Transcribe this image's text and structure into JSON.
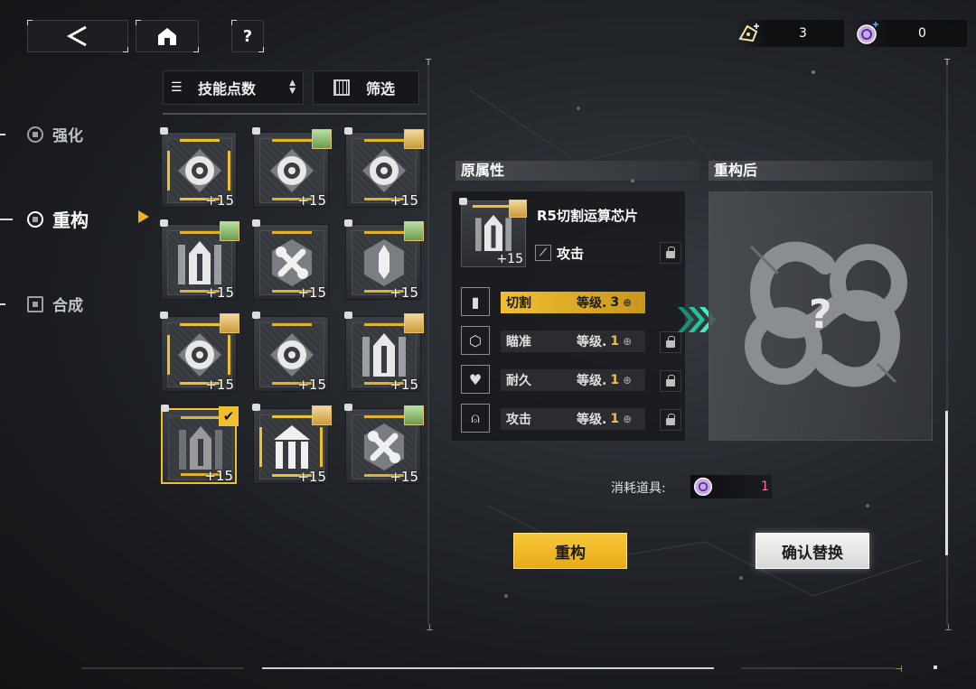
{
  "header": {
    "back_icon": "back-arrow-icon",
    "home_icon": "home-icon",
    "help_icon": "question-icon",
    "resources": [
      {
        "icon": "material-ticket-icon",
        "value": "3"
      },
      {
        "icon": "reconstruct-token-icon",
        "value": "0"
      }
    ]
  },
  "nav": {
    "items": [
      {
        "label": "强化",
        "active": false
      },
      {
        "label": "重构",
        "active": true
      },
      {
        "label": "合成",
        "active": false
      }
    ]
  },
  "toolbar": {
    "sort_label": "技能点数",
    "filter_label": "筛选"
  },
  "inventory": {
    "cards": [
      {
        "icon": "target",
        "level": "+15",
        "avatar": false,
        "gold": true,
        "selected": false
      },
      {
        "icon": "target",
        "level": "+15",
        "avatar": true,
        "gold": false,
        "selected": false
      },
      {
        "icon": "target",
        "level": "+15",
        "avatar": true,
        "gold": false,
        "selected": false
      },
      {
        "icon": "shield-spike",
        "level": "+15",
        "avatar": true,
        "gold": false,
        "selected": false
      },
      {
        "icon": "wrench",
        "level": "+15",
        "avatar": false,
        "gold": false,
        "selected": false
      },
      {
        "icon": "blade",
        "level": "+15",
        "avatar": true,
        "gold": false,
        "selected": false
      },
      {
        "icon": "target",
        "level": "+15",
        "avatar": true,
        "gold": true,
        "selected": false
      },
      {
        "icon": "target",
        "level": "+15",
        "avatar": false,
        "gold": false,
        "selected": false
      },
      {
        "icon": "shield-spike",
        "level": "+15",
        "avatar": true,
        "gold": false,
        "selected": false
      },
      {
        "icon": "shield-spike",
        "level": "+15",
        "avatar": false,
        "gold": false,
        "selected": true
      },
      {
        "icon": "pillars",
        "level": "+15",
        "avatar": true,
        "gold": true,
        "selected": false
      },
      {
        "icon": "wrench",
        "level": "+15",
        "avatar": true,
        "gold": false,
        "selected": false
      }
    ]
  },
  "original": {
    "header": "原属性",
    "chip_name": "R5切割运算芯片",
    "chip_level": "+15",
    "main_stat": "攻击",
    "attributes": [
      {
        "name": "切割",
        "level_label": "等级.",
        "level": "3",
        "highlight": true,
        "locked": false
      },
      {
        "name": "瞄准",
        "level_label": "等级.",
        "level": "1",
        "highlight": false,
        "locked": true
      },
      {
        "name": "耐久",
        "level_label": "等级.",
        "level": "1",
        "highlight": false,
        "locked": true
      },
      {
        "name": "攻击",
        "level_label": "等级.",
        "level": "1",
        "highlight": false,
        "locked": true
      }
    ]
  },
  "result": {
    "header": "重构后",
    "unknown": "?"
  },
  "cost": {
    "label": "消耗道具:",
    "icon": "reconstruct-token-icon",
    "value": "1"
  },
  "actions": {
    "reconstruct_label": "重构",
    "confirm_label": "确认替换"
  },
  "colors": {
    "accent": "#f0c030",
    "accent_dark": "#e0a818",
    "teal": "#2de0b0",
    "panel": "#1b1d21"
  }
}
